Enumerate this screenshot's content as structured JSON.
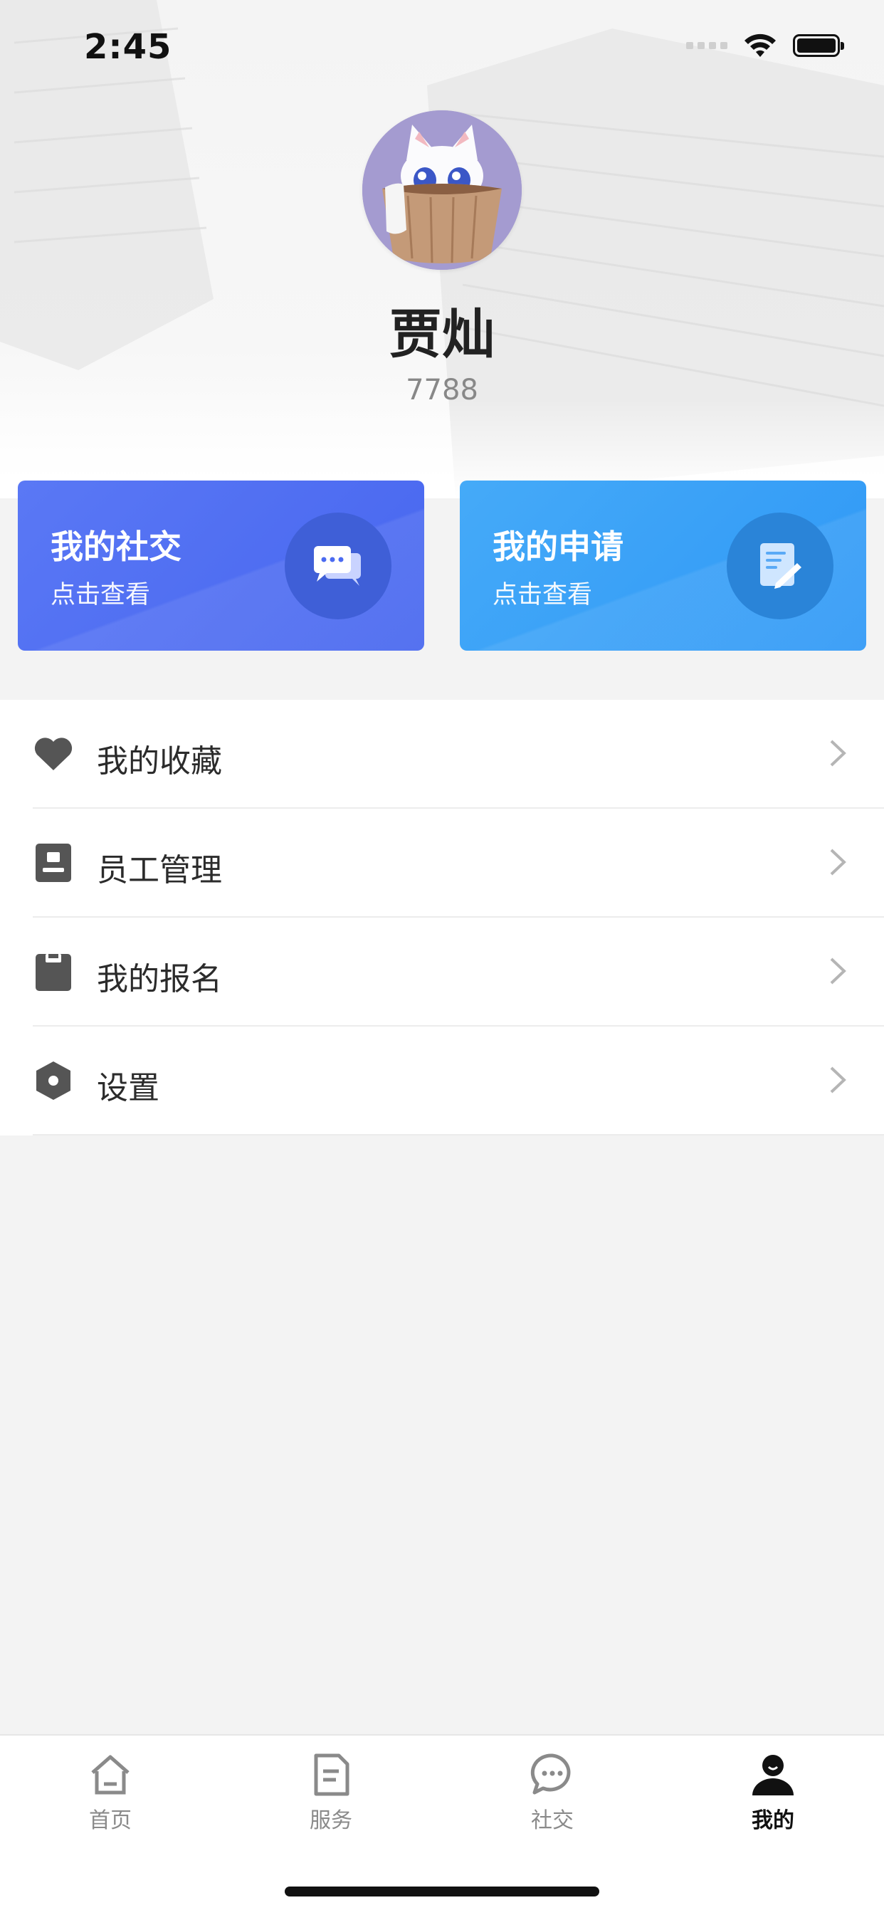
{
  "status_bar": {
    "time": "2:45"
  },
  "profile": {
    "name": "贾灿",
    "id": "7788"
  },
  "cards": [
    {
      "title": "我的社交",
      "subtitle": "点击查看",
      "icon": "chat-bubbles-icon",
      "color": "#4b6bf1"
    },
    {
      "title": "我的申请",
      "subtitle": "点击查看",
      "icon": "document-edit-icon",
      "color": "#339cf7"
    }
  ],
  "menu": [
    {
      "label": "我的收藏",
      "icon": "heart-icon"
    },
    {
      "label": "员工管理",
      "icon": "id-card-icon"
    },
    {
      "label": "我的报名",
      "icon": "clipboard-icon"
    },
    {
      "label": "设置",
      "icon": "hexagon-settings-icon"
    }
  ],
  "tabs": [
    {
      "label": "首页",
      "icon": "home-icon",
      "active": false
    },
    {
      "label": "服务",
      "icon": "document-icon",
      "active": false
    },
    {
      "label": "社交",
      "icon": "chat-icon",
      "active": false
    },
    {
      "label": "我的",
      "icon": "user-icon",
      "active": true
    }
  ],
  "colors": {
    "accent": "#4b6bf1",
    "secondary": "#339cf7",
    "text": "#2b2b2b",
    "muted": "#8a8a8a"
  }
}
